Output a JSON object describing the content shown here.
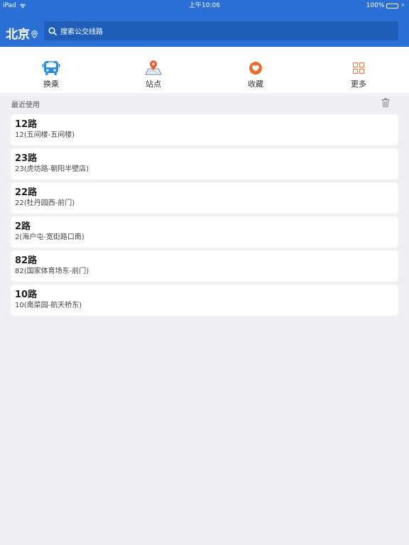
{
  "status_bar": {
    "device": "iPad",
    "time": "上午10:06",
    "battery": "100%"
  },
  "header": {
    "city": "北京",
    "search_placeholder": "搜索公交线路"
  },
  "toolbar": {
    "items": [
      {
        "label": "换乘",
        "icon": "bus-icon",
        "color": "#2a8fe0"
      },
      {
        "label": "站点",
        "icon": "map-pin-icon",
        "color": "#f05a28"
      },
      {
        "label": "收藏",
        "icon": "heart-icon",
        "color": "#f06a28"
      },
      {
        "label": "更多",
        "icon": "grid-icon",
        "color": "#f07a4a"
      }
    ]
  },
  "recent": {
    "title": "最近使用",
    "items": [
      {
        "name": "12路",
        "desc": "12(五间楼-五间楼)"
      },
      {
        "name": "23路",
        "desc": "23(虎坊路-朝阳半壁店)"
      },
      {
        "name": "22路",
        "desc": "22(牡丹园西-前门)"
      },
      {
        "name": "2路",
        "desc": "2(海户屯-宽街路口南)"
      },
      {
        "name": "82路",
        "desc": "82(国家体育场东-前门)"
      },
      {
        "name": "10路",
        "desc": "10(南菜园-航天桥东)"
      }
    ]
  }
}
